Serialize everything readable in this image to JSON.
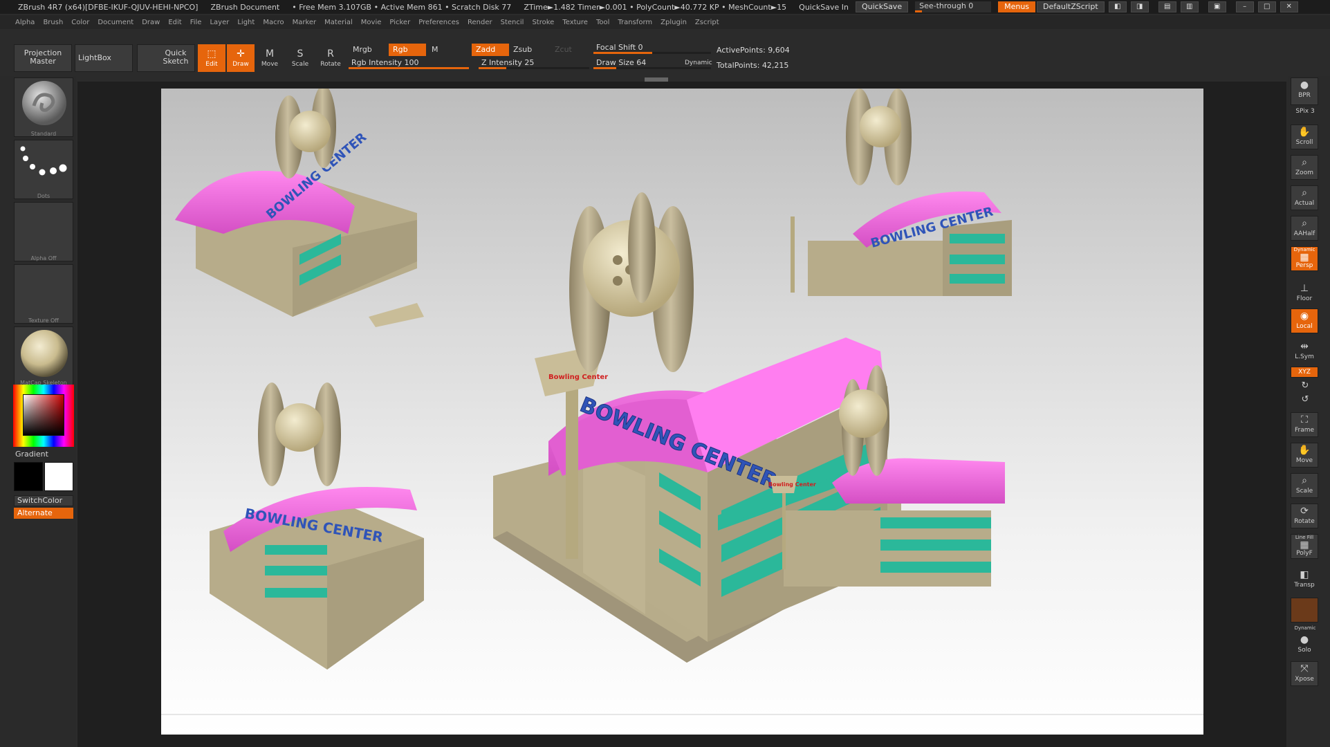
{
  "titlebar": {
    "app": "ZBrush 4R7 (x64)[DFBE-IKUF-QJUV-HEHI-NPCO]",
    "doc": "ZBrush Document",
    "mem": "• Free Mem 3.107GB • Active Mem 861 • Scratch Disk 77",
    "timing": "ZTime►1.482 Timer►0.001 • PolyCount►40.772 KP • MeshCount►15",
    "quicksave_label": "QuickSave In",
    "quicksave": "QuickSave",
    "seethrough": "See-through  0",
    "menus": "Menus",
    "script": "DefaultZScript"
  },
  "menubar": [
    "Alpha",
    "Brush",
    "Color",
    "Document",
    "Draw",
    "Edit",
    "File",
    "Layer",
    "Light",
    "Macro",
    "Marker",
    "Material",
    "Movie",
    "Picker",
    "Preferences",
    "Render",
    "Stencil",
    "Stroke",
    "Texture",
    "Tool",
    "Transform",
    "Zplugin",
    "Zscript"
  ],
  "shelf": {
    "projection_master": "Projection Master",
    "lightbox": "LightBox",
    "quick_sketch": "Quick Sketch",
    "edit": "Edit",
    "draw": "Draw",
    "move": "Move",
    "scale": "Scale",
    "rotate": "Rotate",
    "mrgb": "Mrgb",
    "rgb": "Rgb",
    "m": "M",
    "rgb_intensity": "Rgb Intensity 100",
    "rgb_intensity_value": 100,
    "zadd": "Zadd",
    "zsub": "Zsub",
    "zcut": "Zcut",
    "z_intensity": "Z Intensity 25",
    "z_intensity_value": 25,
    "focal_shift": "Focal Shift 0",
    "focal_shift_value": 0,
    "draw_size": "Draw Size 64",
    "draw_size_value": 64,
    "dynamic": "Dynamic",
    "active_points": "ActivePoints: 9,604",
    "total_points": "TotalPoints: 42,215"
  },
  "lefttray": {
    "brush": "Standard",
    "stroke": "Dots",
    "alpha": "Alpha Off",
    "texture": "Texture Off",
    "material": "MatCap Skeleton",
    "gradient": "Gradient",
    "switchcolor": "SwitchColor",
    "alternate": "Alternate",
    "colors": {
      "main": "#000000",
      "secondary": "#ffffff",
      "accent": "#e6650c"
    }
  },
  "scene": {
    "sign_text": "BOWLING CENTER",
    "small_sign": "Bowling Center",
    "colors": {
      "roof": "#ee66dd",
      "body": "#c4b998",
      "windows": "#2bb89a",
      "letters": "#2f54b8",
      "sign_red": "#d02020"
    }
  },
  "rightshelf": {
    "bpr": "BPR",
    "spix": "SPix 3",
    "scroll": "Scroll",
    "zoom": "Zoom",
    "actual": "Actual",
    "aahalf": "AAHalf",
    "dynamic_top": "Dynamic",
    "persp": "Persp",
    "floor": "Floor",
    "local": "Local",
    "lsym": "L.Sym",
    "xyz": "XYZ",
    "frame": "Frame",
    "move": "Move",
    "scale": "Scale",
    "rotate": "Rotate",
    "linefill": "Line Fill",
    "polyf": "PolyF",
    "transp": "Transp",
    "dynamic": "Dynamic",
    "solo": "Solo",
    "xpose": "Xpose"
  }
}
